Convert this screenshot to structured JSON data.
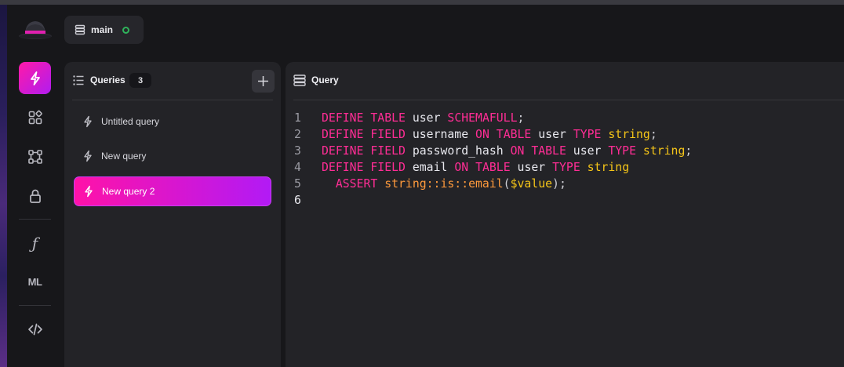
{
  "header": {
    "namespace_label": "main",
    "connection_status": "connected"
  },
  "sidebar": {
    "items": [
      {
        "id": "query",
        "icon": "lightning-icon",
        "active": true
      },
      {
        "id": "explorer",
        "icon": "grid-icon",
        "active": false
      },
      {
        "id": "designer",
        "icon": "graph-icon",
        "active": false
      },
      {
        "id": "authentication",
        "icon": "lock-icon",
        "active": false
      },
      {
        "id": "functions",
        "icon": "function-icon",
        "label": "ƒ",
        "active": false
      },
      {
        "id": "models",
        "icon": "ml-icon",
        "label": "ML",
        "active": false
      },
      {
        "id": "api-docs",
        "icon": "code-icon",
        "active": false
      }
    ]
  },
  "queries_panel": {
    "title": "Queries",
    "count": "3",
    "items": [
      {
        "label": "Untitled query",
        "active": false
      },
      {
        "label": "New query",
        "active": false
      },
      {
        "label": "New query 2",
        "active": true
      }
    ]
  },
  "query_panel": {
    "title": "Query",
    "line_numbers": [
      "1",
      "2",
      "3",
      "4",
      "5",
      "6"
    ],
    "lines": [
      [
        [
          "kw",
          "DEFINE"
        ],
        [
          "sp",
          " "
        ],
        [
          "kw",
          "TABLE"
        ],
        [
          "sp",
          " "
        ],
        [
          "id",
          "user"
        ],
        [
          "sp",
          " "
        ],
        [
          "kw",
          "SCHEMAFULL"
        ],
        [
          "punc",
          ";"
        ]
      ],
      [
        [
          "kw",
          "DEFINE"
        ],
        [
          "sp",
          " "
        ],
        [
          "kw",
          "FIELD"
        ],
        [
          "sp",
          " "
        ],
        [
          "id",
          "username"
        ],
        [
          "sp",
          " "
        ],
        [
          "kw",
          "ON"
        ],
        [
          "sp",
          " "
        ],
        [
          "kw",
          "TABLE"
        ],
        [
          "sp",
          " "
        ],
        [
          "id",
          "user"
        ],
        [
          "sp",
          " "
        ],
        [
          "kw",
          "TYPE"
        ],
        [
          "sp",
          " "
        ],
        [
          "type",
          "string"
        ],
        [
          "punc",
          ";"
        ]
      ],
      [
        [
          "kw",
          "DEFINE"
        ],
        [
          "sp",
          " "
        ],
        [
          "kw",
          "FIELD"
        ],
        [
          "sp",
          " "
        ],
        [
          "id",
          "password_hash"
        ],
        [
          "sp",
          " "
        ],
        [
          "kw",
          "ON"
        ],
        [
          "sp",
          " "
        ],
        [
          "kw",
          "TABLE"
        ],
        [
          "sp",
          " "
        ],
        [
          "id",
          "user"
        ],
        [
          "sp",
          " "
        ],
        [
          "kw",
          "TYPE"
        ],
        [
          "sp",
          " "
        ],
        [
          "type",
          "string"
        ],
        [
          "punc",
          ";"
        ]
      ],
      [
        [
          "kw",
          "DEFINE"
        ],
        [
          "sp",
          " "
        ],
        [
          "kw",
          "FIELD"
        ],
        [
          "sp",
          " "
        ],
        [
          "id",
          "email"
        ],
        [
          "sp",
          " "
        ],
        [
          "kw",
          "ON"
        ],
        [
          "sp",
          " "
        ],
        [
          "kw",
          "TABLE"
        ],
        [
          "sp",
          " "
        ],
        [
          "id",
          "user"
        ],
        [
          "sp",
          " "
        ],
        [
          "kw",
          "TYPE"
        ],
        [
          "sp",
          " "
        ],
        [
          "type",
          "string"
        ]
      ],
      [
        [
          "sp",
          "  "
        ],
        [
          "kw",
          "ASSERT"
        ],
        [
          "sp",
          " "
        ],
        [
          "fn",
          "string::is::email"
        ],
        [
          "punc",
          "("
        ],
        [
          "var",
          "$value"
        ],
        [
          "punc",
          ");"
        ]
      ],
      []
    ]
  },
  "colors": {
    "accent_start": "#ff1aa8",
    "accent_end": "#b01cf0",
    "keyword": "#ff2d95",
    "type": "#f5c518",
    "function": "#ff9a3c",
    "status_connected": "#2fb35b"
  }
}
